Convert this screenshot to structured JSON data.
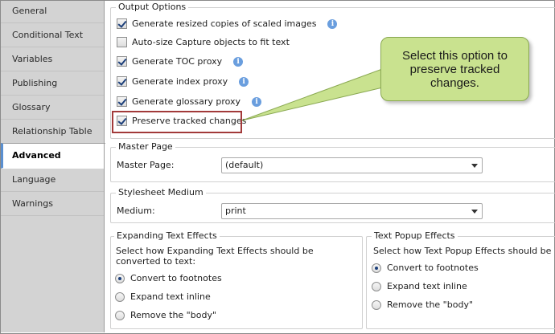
{
  "sidebar": {
    "items": [
      {
        "label": "General",
        "active": false
      },
      {
        "label": "Conditional Text",
        "active": false
      },
      {
        "label": "Variables",
        "active": false
      },
      {
        "label": "Publishing",
        "active": false
      },
      {
        "label": "Glossary",
        "active": false
      },
      {
        "label": "Relationship Table",
        "active": false
      },
      {
        "label": "Advanced",
        "active": true
      },
      {
        "label": "Language",
        "active": false
      },
      {
        "label": "Warnings",
        "active": false
      }
    ]
  },
  "output_options": {
    "title": "Output Options",
    "options": [
      {
        "label": "Generate resized copies of scaled images",
        "checked": true,
        "info": true
      },
      {
        "label": "Auto-size Capture objects to fit text",
        "checked": false,
        "info": false
      },
      {
        "label": "Generate TOC proxy",
        "checked": true,
        "info": true
      },
      {
        "label": "Generate index proxy",
        "checked": true,
        "info": true
      },
      {
        "label": "Generate glossary proxy",
        "checked": true,
        "info": true
      },
      {
        "label": "Preserve tracked changes",
        "checked": true,
        "info": false
      }
    ]
  },
  "master_page": {
    "title": "Master Page",
    "label": "Master Page:",
    "value": "(default)"
  },
  "stylesheet_medium": {
    "title": "Stylesheet Medium",
    "label": "Medium:",
    "value": "print"
  },
  "expanding_text": {
    "title": "Expanding Text Effects",
    "description": "Select how Expanding Text Effects should be converted to text:",
    "options": [
      {
        "label": "Convert to footnotes",
        "checked": true
      },
      {
        "label": "Expand text inline",
        "checked": false
      },
      {
        "label": "Remove the \"body\"",
        "checked": false
      }
    ]
  },
  "popup_text": {
    "title": "Text Popup Effects",
    "description": "Select how Text Popup Effects should be conve",
    "options": [
      {
        "label": "Convert to footnotes",
        "checked": true
      },
      {
        "label": "Expand text inline",
        "checked": false
      },
      {
        "label": "Remove the \"body\"",
        "checked": false
      }
    ]
  },
  "callout": {
    "text": "Select this option to preserve tracked changes."
  },
  "colors": {
    "callout_fill": "#c9e28f",
    "highlight_border": "#a23a3a",
    "active_tab_accent": "#5a8fd0",
    "sidebar_bg": "#d3d3d3"
  }
}
